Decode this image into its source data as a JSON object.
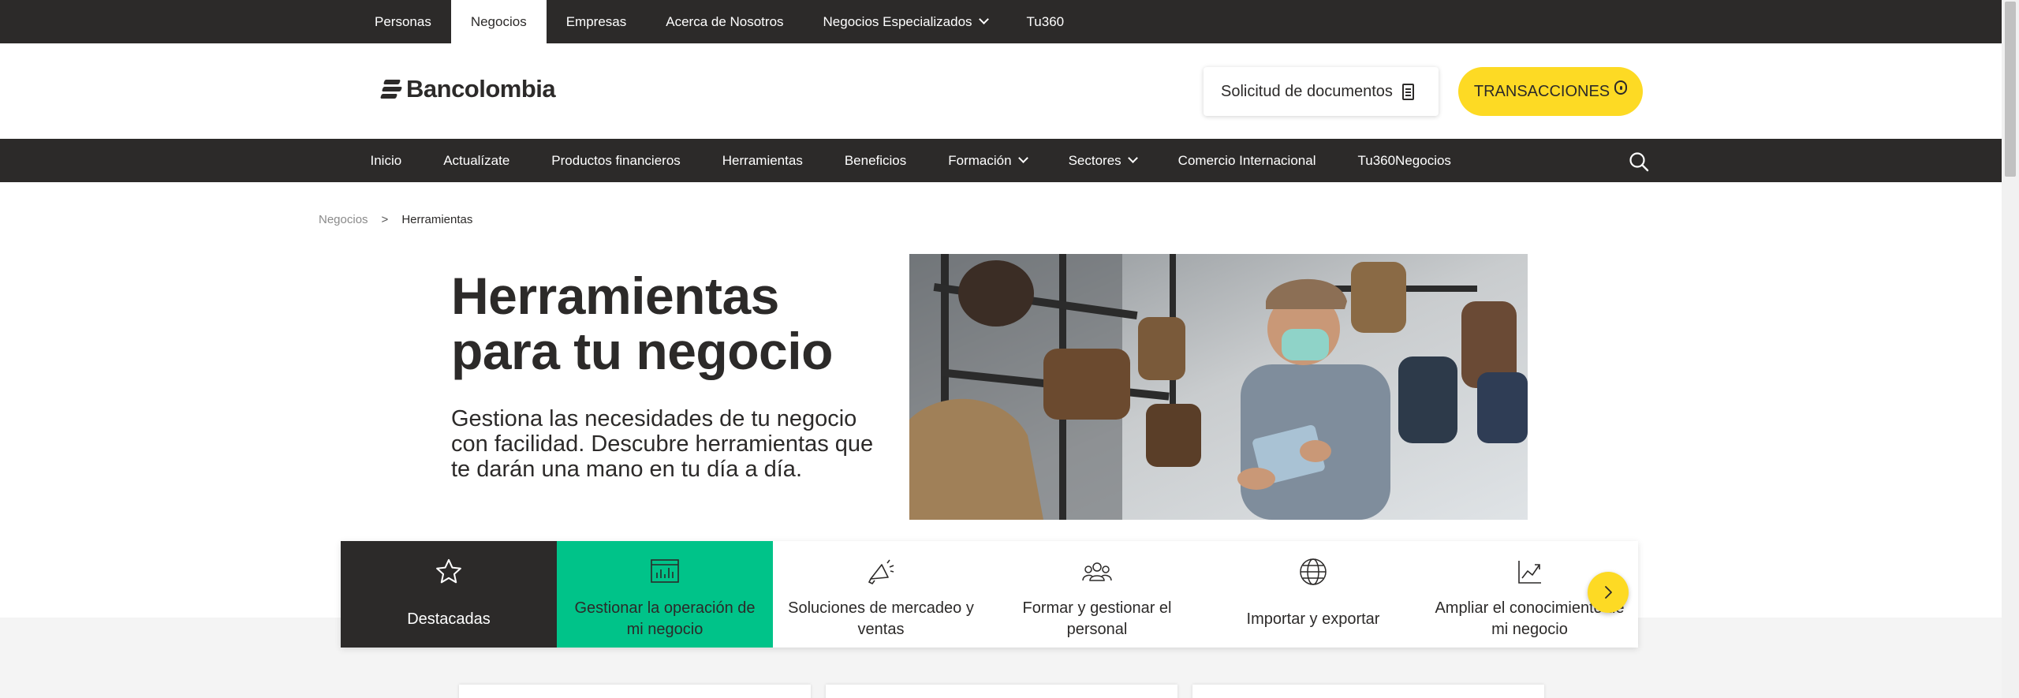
{
  "top_tabs": [
    {
      "label": "Personas"
    },
    {
      "label": "Negocios"
    },
    {
      "label": "Empresas"
    },
    {
      "label": "Acerca de Nosotros"
    },
    {
      "label": "Negocios Especializados"
    },
    {
      "label": "Tu360"
    }
  ],
  "header": {
    "logo_text": "Bancolombia",
    "documents_button": "Solicitud de documentos",
    "transactions_button": "TRANSACCIONES"
  },
  "nav": [
    {
      "label": "Inicio"
    },
    {
      "label": "Actualízate"
    },
    {
      "label": "Productos financieros"
    },
    {
      "label": "Herramientas"
    },
    {
      "label": "Beneficios"
    },
    {
      "label": "Formación"
    },
    {
      "label": "Sectores"
    },
    {
      "label": "Comercio Internacional"
    },
    {
      "label": "Tu360Negocios"
    }
  ],
  "breadcrumb": {
    "parent": "Negocios",
    "separator": ">",
    "current": "Herramientas"
  },
  "hero": {
    "title": "Herramientas para tu negocio",
    "subtitle": "Gestiona las necesidades de tu negocio con facilidad. Descubre herramientas que te darán una mano en tu día a día."
  },
  "categories": [
    {
      "label": "Destacadas",
      "icon": "star-icon"
    },
    {
      "label": "Gestionar la operación de mi negocio",
      "icon": "chart-board-icon"
    },
    {
      "label": "Soluciones de mercadeo y ventas",
      "icon": "megaphone-icon"
    },
    {
      "label": "Formar y gestionar el personal",
      "icon": "people-icon"
    },
    {
      "label": "Importar y exportar",
      "icon": "globe-icon"
    },
    {
      "label": "Ampliar el conocimiento de mi negocio",
      "icon": "trend-chart-icon"
    }
  ],
  "colors": {
    "dark": "#2c2a29",
    "brand_yellow": "#fdda24",
    "accent_green": "#00c389",
    "band_gray": "#f4f4f4"
  }
}
